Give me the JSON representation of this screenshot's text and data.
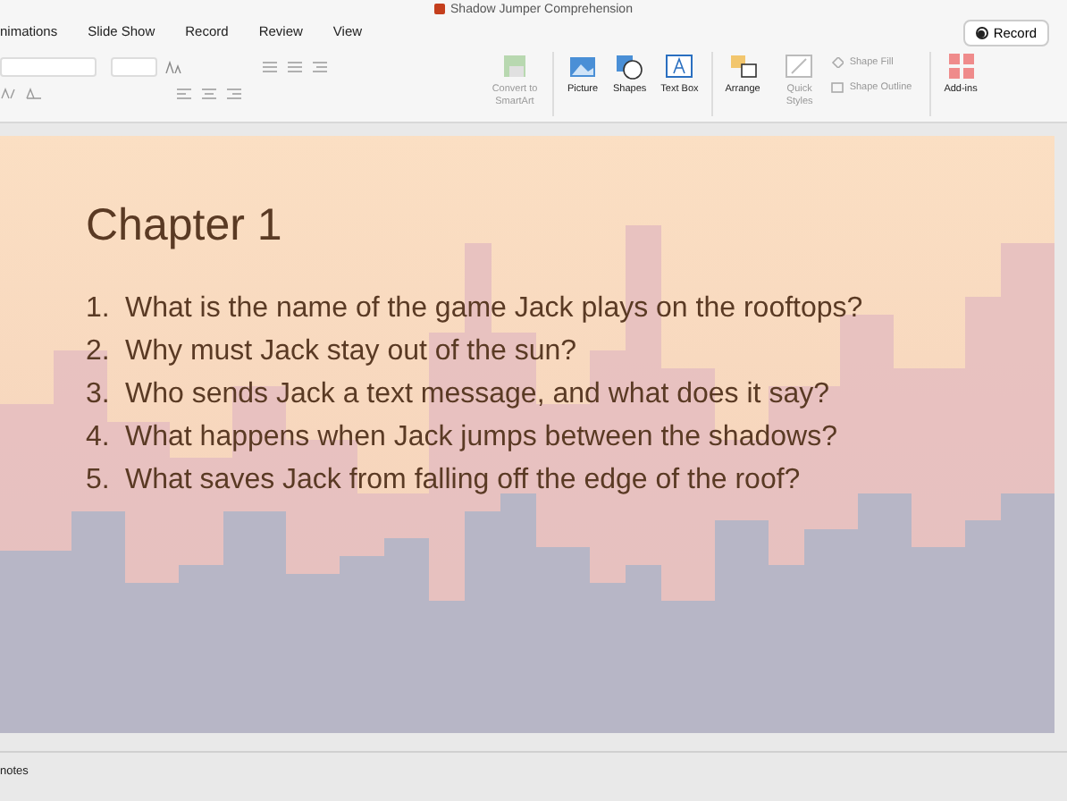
{
  "window": {
    "title": "Shadow Jumper Comprehension"
  },
  "tabs": [
    {
      "label": "nimations",
      "selected": false
    },
    {
      "label": "Slide Show",
      "selected": false
    },
    {
      "label": "Record",
      "selected": false
    },
    {
      "label": "Review",
      "selected": false
    },
    {
      "label": "View",
      "selected": false
    }
  ],
  "record_button": {
    "label": "Record"
  },
  "ribbon": {
    "buttons": [
      {
        "label": "Convert to SmartArt",
        "kind": "smartart",
        "disabled": true
      },
      {
        "label": "Picture",
        "kind": "picture",
        "disabled": false
      },
      {
        "label": "Shapes",
        "kind": "shapes",
        "disabled": false
      },
      {
        "label": "Text Box",
        "kind": "textbox",
        "disabled": false
      },
      {
        "label": "Arrange",
        "kind": "arrange",
        "disabled": false
      },
      {
        "label": "Quick Styles",
        "kind": "styles",
        "disabled": true
      },
      {
        "label": "Shape Fill",
        "kind": "fill",
        "disabled": true
      },
      {
        "label": "Shape Outline",
        "kind": "outline",
        "disabled": true
      },
      {
        "label": "Add-ins",
        "kind": "addins",
        "disabled": false
      }
    ]
  },
  "slide": {
    "title": "Chapter 1",
    "questions": [
      {
        "number": "1.",
        "text": "What is the name of the game Jack plays on the rooftops?"
      },
      {
        "number": "2.",
        "text": "Why must Jack stay out of the sun?"
      },
      {
        "number": "3.",
        "text": "Who sends Jack a text message, and what does it say?"
      },
      {
        "number": "4.",
        "text": "What happens when Jack jumps between the shadows?"
      },
      {
        "number": "5.",
        "text": "What saves Jack from falling off the edge of the roof?"
      }
    ]
  },
  "notes": {
    "label": "notes"
  }
}
